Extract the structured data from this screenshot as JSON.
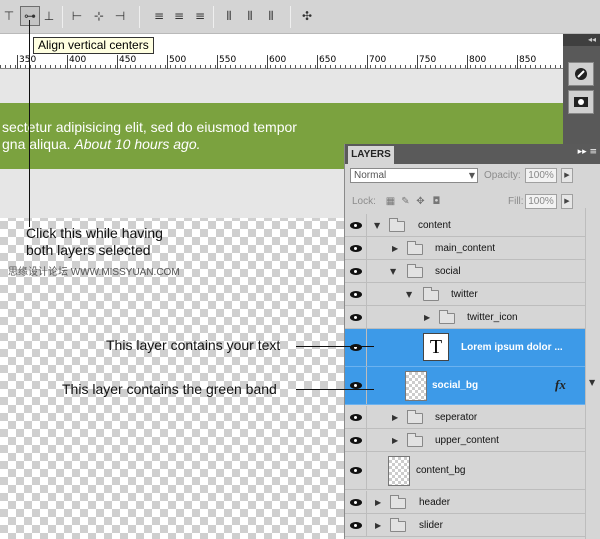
{
  "tooltip": "Align vertical centers",
  "ruler": {
    "labels": [
      "350",
      "400",
      "450",
      "500",
      "550",
      "600",
      "650",
      "700",
      "750",
      "800",
      "850"
    ]
  },
  "canvas": {
    "band_line1": "sectetur adipisicing elit, sed do eiusmod tempor",
    "band_line2": "gna aliqua.",
    "band_time": "About 10 hours ago."
  },
  "annotations": {
    "click_line1": "Click this while having",
    "click_line2": "both layers selected",
    "text_layer": "This layer contains your text",
    "green_layer": "This layer contains the green band"
  },
  "watermark": "思缘设计论坛 WWW.MISSYUAN.COM",
  "layers_panel": {
    "tab": "LAYERS",
    "blend_mode": "Normal",
    "opacity_label": "Opacity:",
    "opacity_value": "100%",
    "lock_label": "Lock:",
    "fill_label": "Fill:",
    "fill_value": "100%",
    "layers": [
      {
        "name": "content",
        "type": "group",
        "expanded": true
      },
      {
        "name": "main_content",
        "type": "group",
        "expanded": false
      },
      {
        "name": "social",
        "type": "group",
        "expanded": true
      },
      {
        "name": "twitter",
        "type": "group",
        "expanded": true
      },
      {
        "name": "twitter_icon",
        "type": "group",
        "expanded": false
      },
      {
        "name": "Lorem ipsum dolor ...",
        "type": "text",
        "selected": true
      },
      {
        "name": "social_bg",
        "type": "pixel",
        "selected": true,
        "effects": true
      },
      {
        "name": "seperator",
        "type": "group",
        "expanded": false
      },
      {
        "name": "upper_content",
        "type": "group",
        "expanded": false
      },
      {
        "name": "content_bg",
        "type": "pixel"
      },
      {
        "name": "header",
        "type": "group",
        "expanded": false
      },
      {
        "name": "slider",
        "type": "group",
        "expanded": false
      }
    ]
  },
  "colors": {
    "green_band": "#7ba23f",
    "selection": "#3d9ae8"
  }
}
